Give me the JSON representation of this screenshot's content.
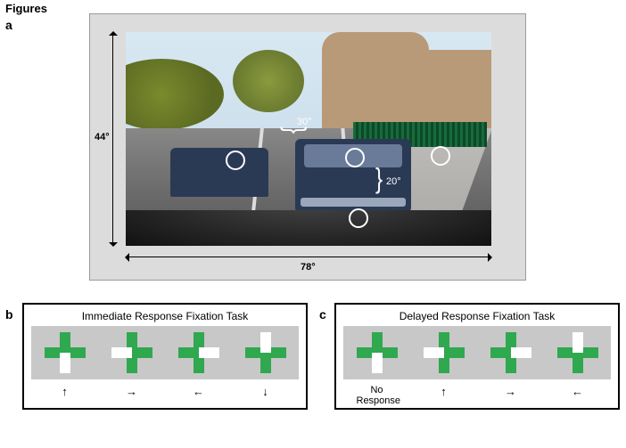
{
  "figures_heading": "Figures",
  "panel_a": {
    "label": "a",
    "width_deg": "78°",
    "height_deg": "44°",
    "inner_h_angle": "30°",
    "inner_v_angle": "20°"
  },
  "panel_b": {
    "label": "b",
    "title": "Immediate Response Fixation Task",
    "crosses": [
      {
        "horiz": "green",
        "vert_top": "green",
        "vert_bot": "white",
        "resp": "↑"
      },
      {
        "horiz_l": "white",
        "horiz_r": "green",
        "vert": "green",
        "resp": "→"
      },
      {
        "horiz_l": "green",
        "horiz_r": "white",
        "vert": "green",
        "resp": "←"
      },
      {
        "horiz": "green",
        "vert_top": "white",
        "vert_bot": "green",
        "resp": "↓"
      }
    ]
  },
  "panel_c": {
    "label": "c",
    "title": "Delayed Response Fixation Task",
    "crosses": [
      {
        "horiz": "green",
        "vert_top": "green",
        "vert_bot": "white",
        "resp": "No Response"
      },
      {
        "horiz_l": "white",
        "horiz_r": "green",
        "vert": "green",
        "resp": "↑"
      },
      {
        "horiz_l": "green",
        "horiz_r": "white",
        "vert": "green",
        "resp": "→"
      },
      {
        "horiz": "green",
        "vert_top": "white",
        "vert_bot": "green",
        "resp": "←"
      }
    ]
  }
}
